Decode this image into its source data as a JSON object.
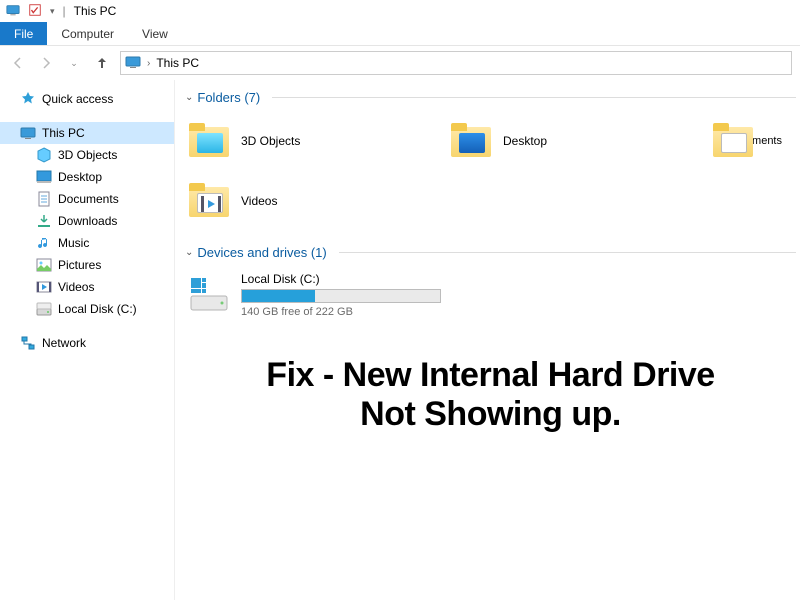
{
  "titlebar": {
    "title": "This PC"
  },
  "ribbon": {
    "file": "File",
    "computer": "Computer",
    "view": "View"
  },
  "breadcrumb": {
    "root_glyph": "›",
    "current": "This PC"
  },
  "sidebar": {
    "quick_access": "Quick access",
    "this_pc": "This PC",
    "children": [
      {
        "label": "3D Objects"
      },
      {
        "label": "Desktop"
      },
      {
        "label": "Documents"
      },
      {
        "label": "Downloads"
      },
      {
        "label": "Music"
      },
      {
        "label": "Pictures"
      },
      {
        "label": "Videos"
      },
      {
        "label": "Local Disk (C:)"
      }
    ],
    "network": "Network"
  },
  "sections": {
    "folders": {
      "title": "Folders (7)"
    },
    "drives": {
      "title": "Devices and drives (1)"
    }
  },
  "folders": [
    {
      "name": "3D Objects"
    },
    {
      "name": "Desktop"
    },
    {
      "name": "Documents"
    },
    {
      "name": "Videos"
    }
  ],
  "drive": {
    "name": "Local Disk (C:)",
    "free_text": "140 GB free of 222 GB",
    "used_percent": 37
  },
  "overlay": {
    "line1": "Fix - New Internal Hard Drive",
    "line2": "Not Showing up."
  }
}
